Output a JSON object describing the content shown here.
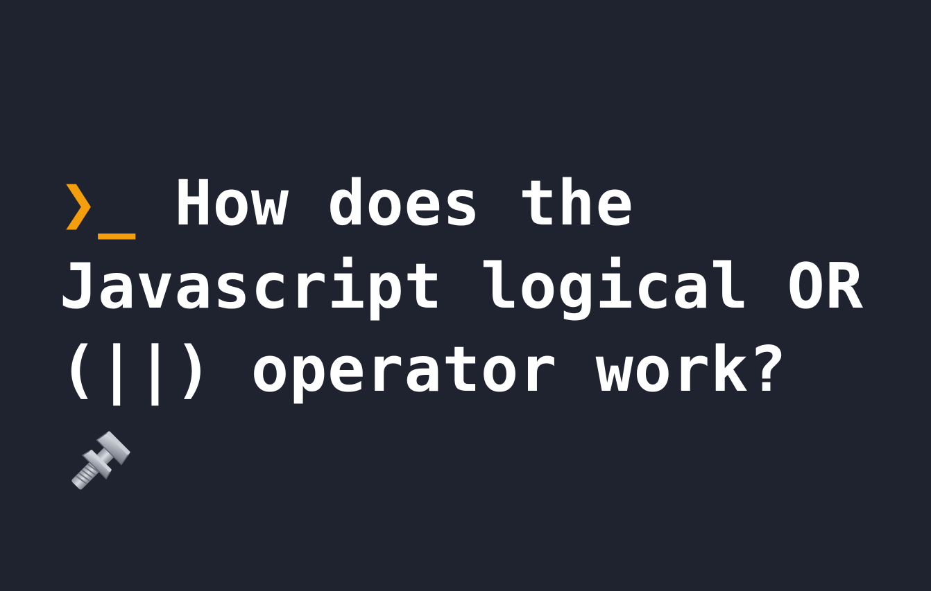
{
  "banner": {
    "prompt_symbol": "❯_ ",
    "heading": "How does the Javascript logical OR (||) operator work?",
    "icon": "nut-and-bolt-icon",
    "colors": {
      "background": "#1f2330",
      "accent": "#f59e0b",
      "text": "#ffffff"
    }
  }
}
